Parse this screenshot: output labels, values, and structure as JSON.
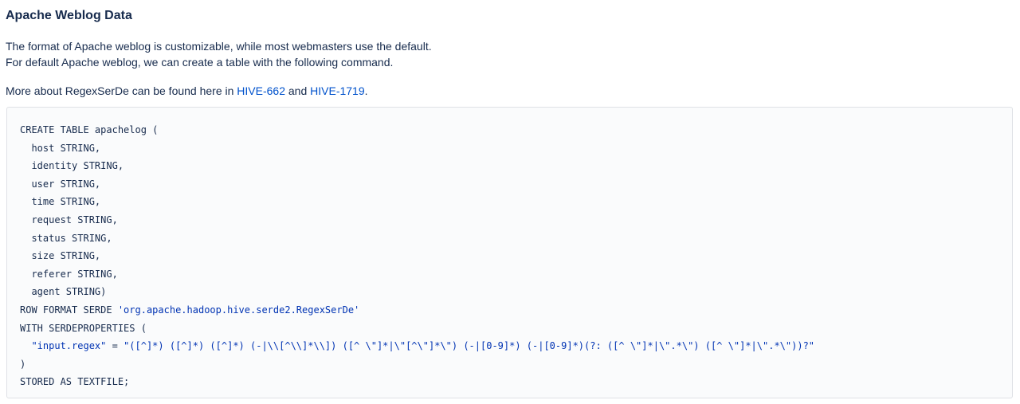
{
  "title": "Apache Weblog Data",
  "intro": {
    "line1": "The format of Apache weblog is customizable, while most webmasters use the default.",
    "line2": "For default Apache weblog, we can create a table with the following command."
  },
  "more": {
    "prefix": "More about RegexSerDe can be found here in ",
    "link1": "HIVE-662",
    "middle": " and ",
    "link2": "HIVE-1719",
    "suffix": "."
  },
  "code": {
    "create": "CREATE TABLE apachelog (",
    "columns": [
      "  host STRING,",
      "  identity STRING,",
      "  user STRING,",
      "  time STRING,",
      "  request STRING,",
      "  status STRING,",
      "  size STRING,",
      "  referer STRING,",
      "  agent STRING)"
    ],
    "row_format_prefix": "ROW FORMAT SERDE ",
    "serde_class": "'org.apache.hadoop.hive.serde2.RegexSerDe'",
    "with_props": "WITH SERDEPROPERTIES (",
    "prop_indent": "  ",
    "prop_key": "\"input.regex\"",
    "prop_eq": " = ",
    "prop_value": "\"([^]*) ([^]*) ([^]*) (-|\\\\[^\\\\]*\\\\]) ([^ \\\"]*|\\\"[^\\\"]*\\\") (-|[0-9]*) (-|[0-9]*)(?: ([^ \\\"]*|\\\".*\\\") ([^ \\\"]*|\\\".*\\\"))?\"",
    "close_paren": ")",
    "stored_as": "STORED AS TEXTFILE;"
  },
  "colors": {
    "text": "#172b4d",
    "link": "#0052cc",
    "code_string": "#0033b3",
    "code_bg": "#fafbfc",
    "code_border": "#dfe1e6"
  }
}
